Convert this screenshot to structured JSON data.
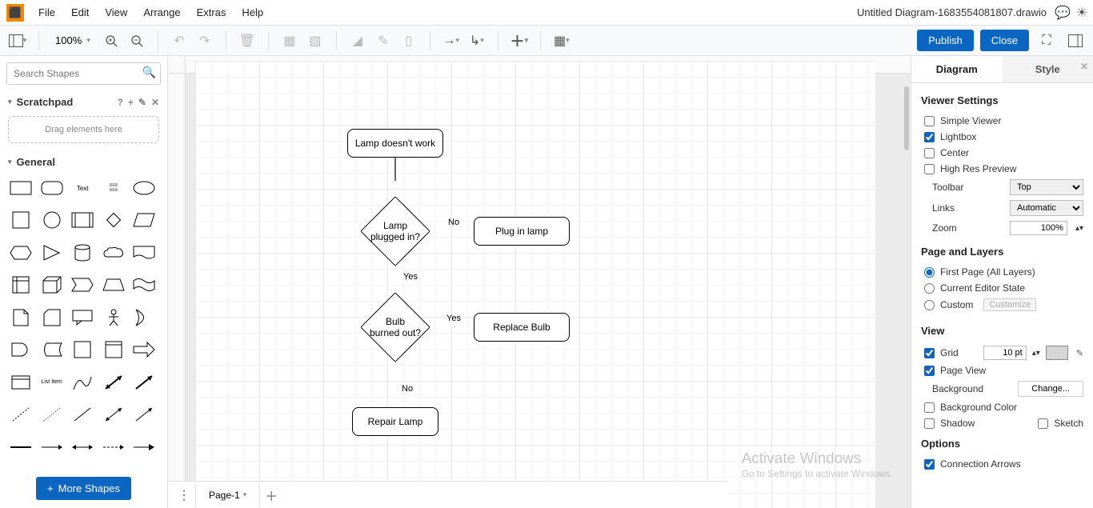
{
  "menubar": {
    "items": [
      "File",
      "Edit",
      "View",
      "Arrange",
      "Extras",
      "Help"
    ],
    "docTitle": "Untitled Diagram-1683554081807.drawio"
  },
  "toolbar": {
    "zoom": "100%",
    "publish": "Publish",
    "close": "Close"
  },
  "leftPanel": {
    "searchPlaceholder": "Search Shapes",
    "scratchpad": "Scratchpad",
    "dragHint": "Drag elements here",
    "general": "General",
    "moreShapes": "More Shapes"
  },
  "flow": {
    "start": "Lamp doesn't work",
    "d1": "Lamp\nplugged in?",
    "d1no": "No",
    "a1": "Plug in lamp",
    "d1yes": "Yes",
    "d2": "Bulb\nburned out?",
    "d2yes": "Yes",
    "a2": "Replace Bulb",
    "d2no": "No",
    "end": "Repair Lamp"
  },
  "rightPanel": {
    "tabs": {
      "diagram": "Diagram",
      "style": "Style"
    },
    "viewerSettings": "Viewer Settings",
    "simpleViewer": "Simple Viewer",
    "lightbox": "Lightbox",
    "center": "Center",
    "highRes": "High Res Preview",
    "toolbarLbl": "Toolbar",
    "toolbarVal": "Top",
    "linksLbl": "Links",
    "linksVal": "Automatic",
    "zoomLbl": "Zoom",
    "zoomVal": "100%",
    "pageLayers": "Page and Layers",
    "firstPage": "First Page (All Layers)",
    "currentEditor": "Current Editor State",
    "custom": "Custom",
    "customize": "Customize",
    "view": "View",
    "grid": "Grid",
    "gridVal": "10 pt",
    "pageView": "Page View",
    "background": "Background",
    "change": "Change...",
    "bgColor": "Background Color",
    "shadow": "Shadow",
    "sketch": "Sketch",
    "options": "Options",
    "connArrows": "Connection Arrows"
  },
  "footer": {
    "page1": "Page-1"
  },
  "watermark": {
    "title": "Activate Windows",
    "sub": "Go to Settings to activate Windows."
  }
}
